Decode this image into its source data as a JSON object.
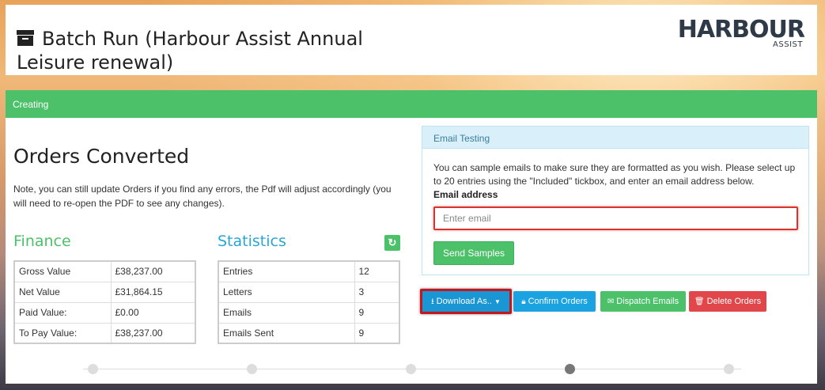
{
  "page": {
    "title": "Batch Run (Harbour Assist Annual Leisure renewal)",
    "logo_main": "HARBOUR",
    "logo_sub": "ASSIST",
    "status": "Creating"
  },
  "orders": {
    "title": "Orders Converted",
    "note": "Note, you can still update Orders if you find any errors, the Pdf will adjust accordingly (you will need to re-open the PDF to see any changes)."
  },
  "finance": {
    "title": "Finance",
    "rows": [
      {
        "label": "Gross Value",
        "value": "£38,237.00"
      },
      {
        "label": "Net Value",
        "value": "£31,864.15"
      },
      {
        "label": "Paid Value:",
        "value": "£0.00"
      },
      {
        "label": "To Pay Value:",
        "value": "£38,237.00"
      }
    ]
  },
  "statistics": {
    "title": "Statistics",
    "refresh_icon": "refresh-icon",
    "rows": [
      {
        "label": "Entries",
        "value": "12"
      },
      {
        "label": "Letters",
        "value": "3"
      },
      {
        "label": "Emails",
        "value": "9"
      },
      {
        "label": "Emails Sent",
        "value": "9"
      }
    ]
  },
  "email_testing": {
    "title": "Email Testing",
    "description": "You can sample emails to make sure they are formatted as you wish. Please select up to 20 entries using the \"Included\" tickbox, and enter an email address below.",
    "label": "Email address",
    "placeholder": "Enter email",
    "send_label": "Send Samples"
  },
  "actions": {
    "download_label": "Download As..",
    "confirm_label": "Confirm Orders",
    "dispatch_label": "Dispatch Emails",
    "delete_label": "Delete Orders"
  },
  "progress": {
    "steps": 5,
    "current_step": 4
  },
  "colors": {
    "accent_green": "#4cc16a",
    "accent_blue": "#1aa3e0",
    "danger_red": "#e0464a",
    "stats_title": "#2aa5d6"
  }
}
